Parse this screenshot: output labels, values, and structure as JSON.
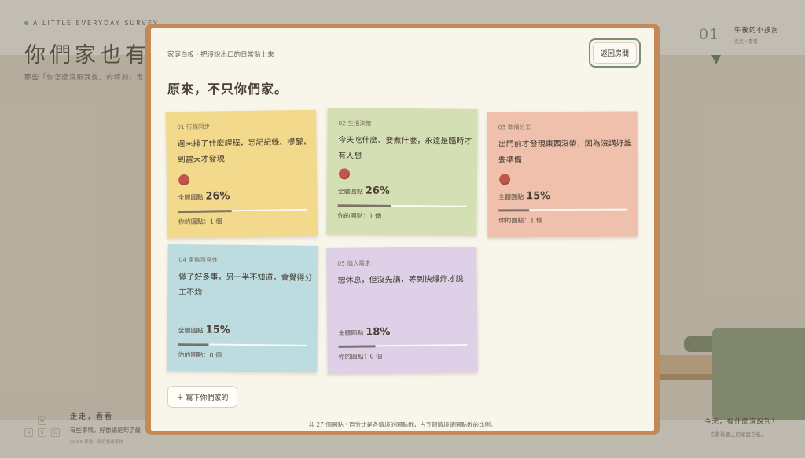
{
  "background": {
    "eyebrow": "A LITTLE EVERYDAY SURVEY",
    "title": "你們家也有嗎",
    "subtitle": "那些「你怎麼沒跟我說」的時刻，走",
    "room_number": "01",
    "room_name": "午後的小孩房",
    "room_sub": "走走・看看",
    "walk_title": "走走，看看",
    "walk_sub": "有些事情，好像總是到了最",
    "walk_hint": "WASD 移動 · 靠近看看事物",
    "keys": [
      "W",
      "A",
      "S",
      "D"
    ],
    "today_title": "今天，有什麼沒說到？",
    "today_sub": "去看看牆上的家庭白板。"
  },
  "board": {
    "caption": "家庭白板 · 把沒說出口的日常貼上來",
    "heading": "原來，不只你們家。",
    "back_label": "返回房間",
    "add_label": "＋ 寫下你們家的",
    "footer": "共 27 個圓點 · 百分比是各情境的圓點數，占五個情境總圓點數的比例。",
    "total_label": "全體圓點",
    "notes": [
      {
        "label": "01 行程同步",
        "text": "週末排了什麼課程，忘記紀錄、提醒，到當天才發現",
        "percent": "26%",
        "mine": "你的圓點：1 個",
        "fill": 0.26,
        "pinned": true,
        "color": "#f3d98c"
      },
      {
        "label": "02 生活決策",
        "text": "今天吃什麼、要煮什麼，永遠是臨時才有人想",
        "percent": "26%",
        "mine": "你的圓點：1 個",
        "fill": 0.26,
        "pinned": true,
        "color": "#d4dfb3"
      },
      {
        "label": "03 準備分工",
        "text": "出門前才發現東西沒帶，因為沒講好誰要準備",
        "percent": "15%",
        "mine": "你的圓點：1 個",
        "fill": 0.15,
        "pinned": true,
        "color": "#efc0ab"
      },
      {
        "label": "04 家務可見性",
        "text": "做了好多事，另一半不知道，會覺得分工不均",
        "percent": "15%",
        "mine": "你的圓點：0 個",
        "fill": 0.15,
        "pinned": false,
        "color": "#bcdcdf"
      },
      {
        "label": "05 個人需求",
        "text": "想休息，但沒先講，等到快爆炸才說",
        "percent": "18%",
        "mine": "你的圓點：0 個",
        "fill": 0.18,
        "pinned": false,
        "color": "#ddd0e7"
      }
    ]
  }
}
